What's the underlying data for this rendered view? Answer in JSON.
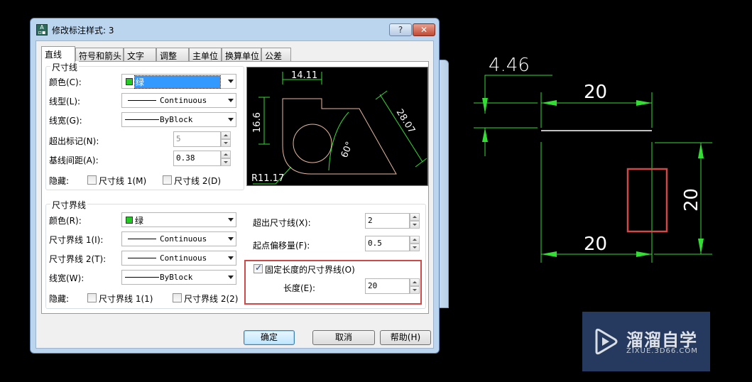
{
  "dialog": {
    "title": "修改标注样式: 3",
    "help_button": "?",
    "close_button": "✕",
    "tabs": [
      {
        "label": "直线",
        "active": true
      },
      {
        "label": "符号和箭头",
        "active": false
      },
      {
        "label": "文字",
        "active": false
      },
      {
        "label": "调整",
        "active": false
      },
      {
        "label": "主单位",
        "active": false
      },
      {
        "label": "换算单位",
        "active": false
      },
      {
        "label": "公差",
        "active": false
      }
    ],
    "dim_lines": {
      "group_title": "尺寸线",
      "color_label": "颜色(C):",
      "color_value": "绿",
      "linetype_label": "线型(L):",
      "linetype_value": "Continuous",
      "lineweight_label": "线宽(G):",
      "lineweight_value": "ByBlock",
      "extend_ticks_label": "超出标记(N):",
      "extend_ticks_value": "5",
      "baseline_spacing_label": "基线间距(A):",
      "baseline_spacing_value": "0.38",
      "suppress_label": "隐藏:",
      "suppress_1_label": "尺寸线 1(M)",
      "suppress_1_checked": false,
      "suppress_2_label": "尺寸线 2(D)",
      "suppress_2_checked": false
    },
    "ext_lines": {
      "group_title": "尺寸界线",
      "color_label": "颜色(R):",
      "color_value": "绿",
      "ext1_linetype_label": "尺寸界线 1(I):",
      "ext1_linetype_value": "Continuous",
      "ext2_linetype_label": "尺寸界线 2(T):",
      "ext2_linetype_value": "Continuous",
      "lineweight_label": "线宽(W):",
      "lineweight_value": "ByBlock",
      "suppress_label": "隐藏:",
      "suppress_1_label": "尺寸界线 1(1)",
      "suppress_1_checked": false,
      "suppress_2_label": "尺寸界线 2(2)",
      "suppress_2_checked": false,
      "extend_beyond_label": "超出尺寸线(X):",
      "extend_beyond_value": "2",
      "offset_label": "起点偏移量(F):",
      "offset_value": "0.5",
      "fixed_length_label": "固定长度的尺寸界线(O)",
      "fixed_length_checked": true,
      "length_label": "长度(E):",
      "length_value": "20"
    },
    "preview": {
      "dim_top": "14.11",
      "dim_left": "16.6",
      "dim_slant": "28.07",
      "dim_angle": "60°",
      "dim_radius": "R11.17"
    },
    "buttons": {
      "ok": "确定",
      "cancel": "取消",
      "help": "帮助(H)"
    }
  },
  "drawing": {
    "dim_small": "4.46",
    "dim_top": "20",
    "dim_bottom": "20",
    "dim_right": "20"
  },
  "watermark": {
    "title": "溜溜自学",
    "subtitle": "ZIXUE.3D66.COM"
  },
  "colors": {
    "dim_green": "#33dd33",
    "text_white": "#ffffff",
    "highlight_red": "#d04848",
    "preview_outline": "#e8b8a0"
  }
}
